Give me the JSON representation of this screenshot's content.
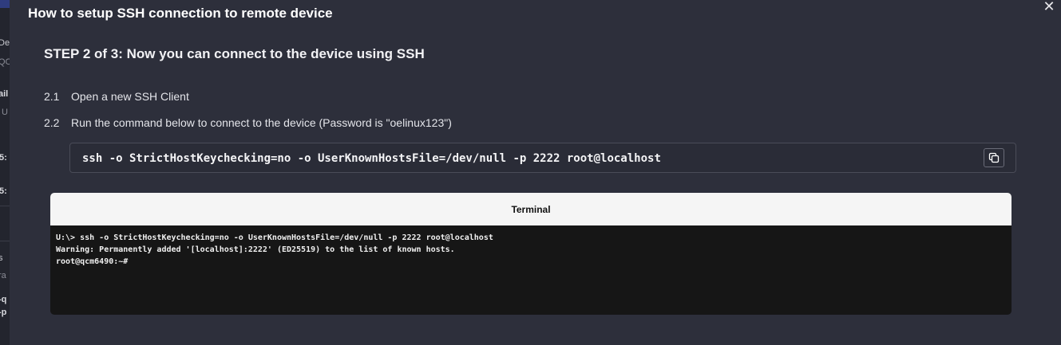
{
  "background": {
    "fragments": [
      "De",
      "QC",
      "ail",
      "U",
      "5:",
      "5:",
      "s",
      "ra",
      "-q",
      "-p"
    ]
  },
  "modal": {
    "title": "How to setup SSH connection to remote device",
    "close_glyph": "✕",
    "step_title": "STEP 2 of 3: Now you can connect to the device using SSH",
    "steps": [
      {
        "number": "2.1",
        "text": "Open a new SSH Client"
      },
      {
        "number": "2.2",
        "text": "Run the command below to connect to the device (Password is \"oelinux123\")"
      }
    ],
    "command": "ssh -o StrictHostKeychecking=no -o UserKnownHostsFile=/dev/null -p 2222 root@localhost",
    "copy_icon": "copy-icon",
    "terminal": {
      "title": "Terminal",
      "lines": [
        "U:\\> ssh -o StrictHostKeychecking=no -o UserKnownHostsFile=/dev/null -p 2222 root@localhost",
        "Warning: Permanently added '[localhost]:2222' (ED25519) to the list of known hosts.",
        "root@qcm6490:~#"
      ]
    }
  },
  "colors": {
    "modal_bg": "#2d2f3b",
    "terminal_bg": "#161616",
    "terminal_header_bg": "#f5f5f5"
  }
}
